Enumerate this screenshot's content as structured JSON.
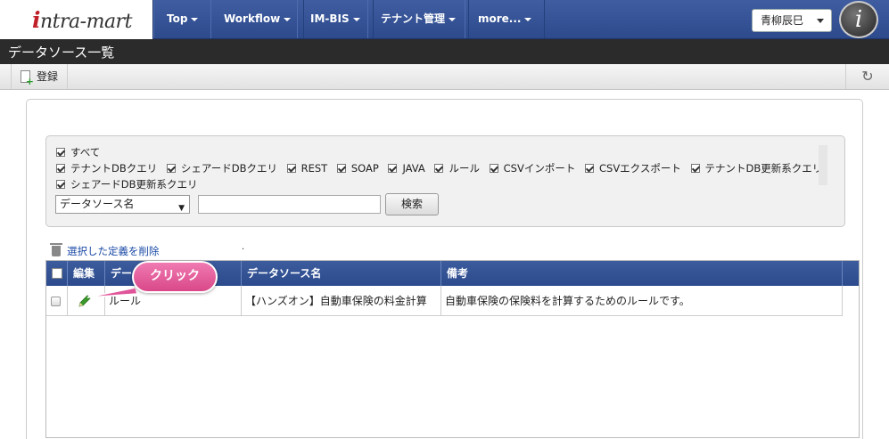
{
  "header": {
    "logo_text": "intra-mart",
    "nav": [
      {
        "label": "Top"
      },
      {
        "label": "Workflow"
      },
      {
        "label": "IM-BIS"
      },
      {
        "label": "テナント管理"
      },
      {
        "label": "more..."
      }
    ],
    "user_name": "青柳辰巳",
    "info_icon": "i"
  },
  "page": {
    "title": "データソース一覧"
  },
  "toolbar": {
    "register_label": "登録",
    "refresh_icon": "refresh-icon"
  },
  "search": {
    "all_label": "すべて",
    "checkboxes_row1": [
      "テナントDBクエリ",
      "シェアードDBクエリ",
      "REST",
      "SOAP",
      "JAVA",
      "ルール",
      "CSVインポート",
      "CSVエクスポート",
      "テナントDB更新系クエリ"
    ],
    "checkboxes_row2": [
      "シェアードDB更新系クエリ"
    ],
    "field_select": "データソース名",
    "search_button": "検索"
  },
  "actions": {
    "delete_selected": "選択した定義を削除"
  },
  "table": {
    "columns": [
      "編集",
      "データソース種別",
      "データソース名",
      "備考"
    ],
    "rows": [
      {
        "type": "ルール",
        "name": "【ハンズオン】自動車保険の料金計算",
        "note": "自動車保険の保険料を計算するためのルールです。"
      }
    ]
  },
  "callout": {
    "label": "クリック"
  },
  "colors": {
    "nav_blue": "#2c4a8c",
    "callout_pink": "#e0559a",
    "pencil_green": "#3a9a2a"
  }
}
